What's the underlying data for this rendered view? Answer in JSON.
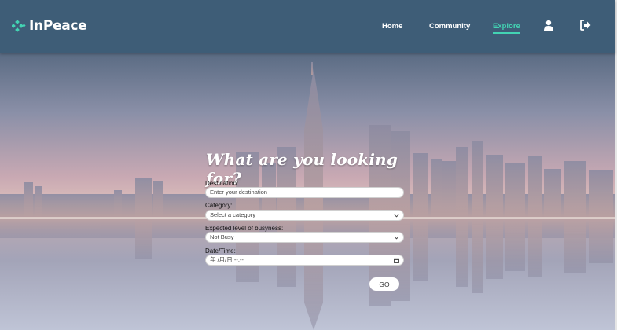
{
  "brand": {
    "name": "InPeace",
    "accent": "#43d3b3"
  },
  "nav": {
    "links": [
      "Home",
      "Community",
      "Explore"
    ],
    "active": "Explore",
    "background": "#3e5d77",
    "icons": [
      "user-icon",
      "logout-icon"
    ]
  },
  "form": {
    "title": "What are you looking for?",
    "destination": {
      "label": "Destination:",
      "placeholder": "Enter your destination"
    },
    "category": {
      "label": "Category:",
      "value": "Select a category"
    },
    "busyness": {
      "label": "Expected level of busyness:",
      "value": "Not Busy"
    },
    "datetime": {
      "label": "Date/Time:",
      "value": "年 /月/日 --:--"
    },
    "submit_label": "GO"
  }
}
